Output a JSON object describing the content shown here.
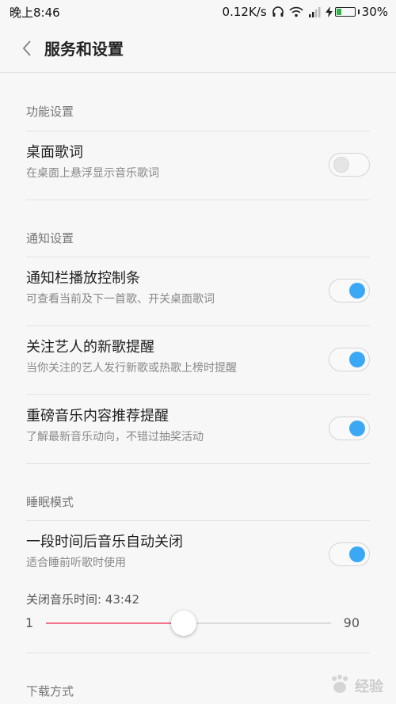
{
  "status_bar": {
    "time": "晚上8:46",
    "network_speed": "0.12K/s",
    "battery_percent": "30%",
    "battery_level": 0.3,
    "icons": [
      "headset-icon",
      "wifi-icon",
      "signal-icon",
      "charging-icon",
      "battery-icon"
    ]
  },
  "header": {
    "title": "服务和设置"
  },
  "sections": [
    {
      "header": "功能设置",
      "items": [
        {
          "title": "桌面歌词",
          "subtitle": "在桌面上悬浮显示音乐歌词",
          "enabled": false
        }
      ]
    },
    {
      "header": "通知设置",
      "items": [
        {
          "title": "通知栏播放控制条",
          "subtitle": "可查看当前及下一首歌、开关桌面歌词",
          "enabled": true
        },
        {
          "title": "关注艺人的新歌提醒",
          "subtitle": "当你关注的艺人发行新歌或热歌上榜时提醒",
          "enabled": true
        },
        {
          "title": "重磅音乐内容推荐提醒",
          "subtitle": "了解最新音乐动向，不错过抽奖活动",
          "enabled": true
        }
      ]
    },
    {
      "header": "睡眠模式",
      "items": [
        {
          "title": "一段时间后音乐自动关闭",
          "subtitle": "适合睡前听歌时使用",
          "enabled": true
        }
      ]
    },
    {
      "header": "下载方式"
    }
  ],
  "sleep_timer": {
    "label": "关闭音乐时间: 43:42",
    "min_label": "1",
    "max_label": "90",
    "min": 1,
    "max": 90,
    "value": 44
  },
  "colors": {
    "accent": "#3ba8f5",
    "slider_fill": "#f2748c"
  },
  "watermark": {
    "text": "经验"
  }
}
